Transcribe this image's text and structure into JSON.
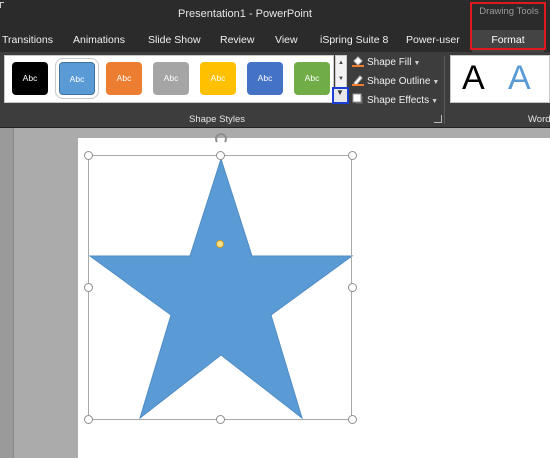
{
  "window": {
    "title": "Presentation1 - PowerPoint"
  },
  "context": {
    "label": "Drawing Tools"
  },
  "tabs": [
    {
      "label": "Transitions"
    },
    {
      "label": "Animations"
    },
    {
      "label": "Slide Show"
    },
    {
      "label": "Review"
    },
    {
      "label": "View"
    },
    {
      "label": "iSpring Suite 8"
    },
    {
      "label": "Power-user"
    },
    {
      "label": "Format"
    }
  ],
  "shape_styles": {
    "swatches": [
      {
        "label": "Abc",
        "color": "#000000"
      },
      {
        "label": "Abc",
        "color": "#5b9bd5"
      },
      {
        "label": "Abc",
        "color": "#ed7d31"
      },
      {
        "label": "Abc",
        "color": "#a5a5a5"
      },
      {
        "label": "Abc",
        "color": "#ffc000"
      },
      {
        "label": "Abc",
        "color": "#4472c4"
      },
      {
        "label": "Abc",
        "color": "#70ad47"
      }
    ],
    "commands": {
      "fill": "Shape Fill",
      "outline": "Shape Outline",
      "effects": "Shape Effects"
    },
    "group_label": "Shape Styles"
  },
  "wordart": {
    "samples": [
      {
        "glyph": "A",
        "color": "#000000"
      },
      {
        "glyph": "A",
        "color": "#5b9bd5"
      }
    ],
    "group_label": "Word"
  },
  "shape": {
    "type": "star",
    "fill": "#5b9bd5"
  },
  "colors": {
    "highlight_red": "#e0191e",
    "highlight_blue": "#1a3ed4"
  }
}
